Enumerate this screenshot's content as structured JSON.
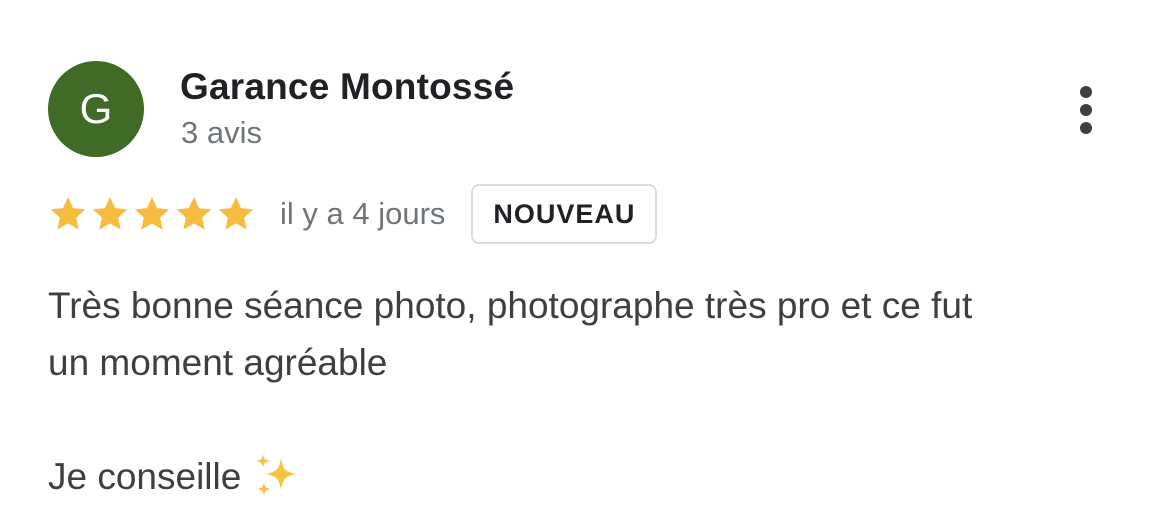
{
  "author": {
    "initial": "G",
    "name": "Garance Montossé",
    "review_count": "3 avis",
    "avatar_color": "#3f6b26"
  },
  "rating": {
    "stars": 5,
    "max": 5,
    "star_color": "#f6bb3f"
  },
  "date": "il y a 4 jours",
  "badge": "NOUVEAU",
  "body": {
    "line1": "Très bonne séance photo, photographe très pro et ce fut",
    "line2": "un moment agréable",
    "line3": "Je conseille"
  },
  "icons": {
    "menu": "more-vertical-icon",
    "emoji": "sparkles-icon"
  }
}
